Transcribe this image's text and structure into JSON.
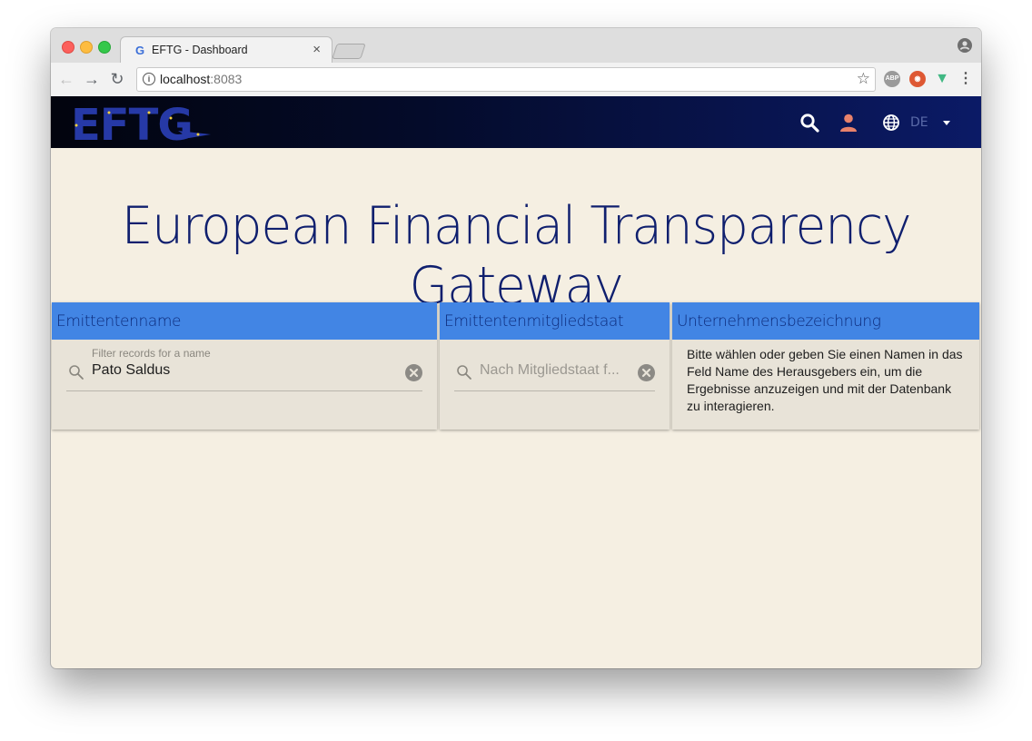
{
  "browser": {
    "tab_title": "EFTG - Dashboard",
    "tab_close": "×",
    "url_host": "localhost",
    "url_port": ":8083",
    "extensions": [
      "abp-icon",
      "duckduckgo-icon",
      "vue-devtools-icon",
      "menu-icon"
    ]
  },
  "appbar": {
    "logo_text": "EFTG",
    "lang_code": "DE",
    "accent": "#e9826b"
  },
  "hero": {
    "title": "European Financial Transparency Gateway"
  },
  "panels": {
    "issuer_name": {
      "header": "Emittentenname",
      "label": "Filter records for a name",
      "value": "Pato Saldus"
    },
    "issuer_member_state": {
      "header": "Emittentenmitgliedstaat",
      "placeholder": "Nach Mitgliedstaat f..."
    },
    "company_name": {
      "header": "Unternehmensbezeichnung",
      "message": "Bitte wählen oder geben Sie einen Namen in das Feld Name des Herausgebers ein, um die Ergebnisse anzuzeigen und mit der Datenbank zu interagieren."
    }
  },
  "colors": {
    "panel_header": "#4285e4",
    "page_background": "#f5efe2",
    "hero_text": "#0f1f6e"
  }
}
